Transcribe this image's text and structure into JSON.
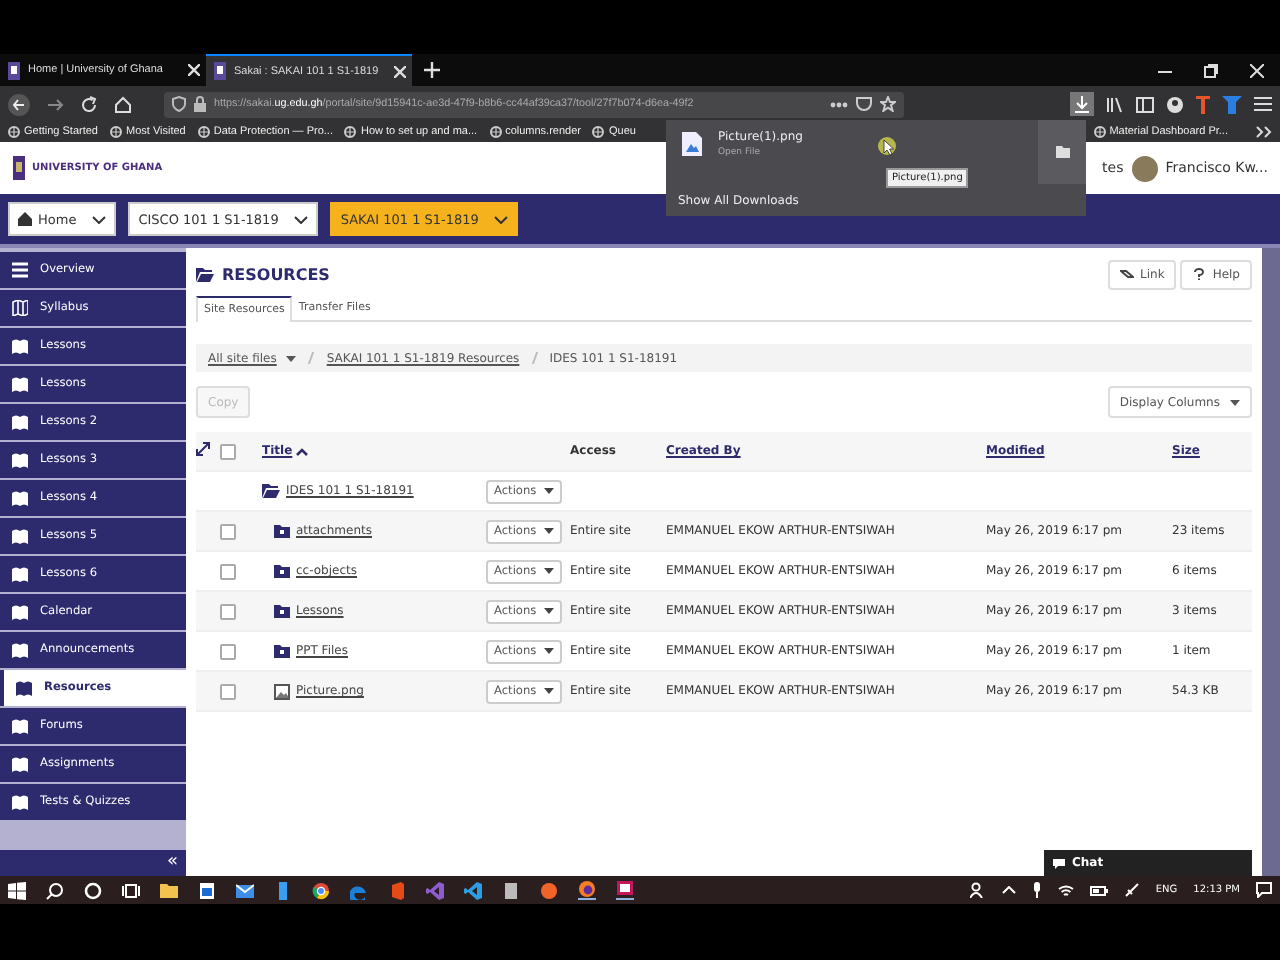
{
  "browser": {
    "tabs": [
      {
        "title": "Home | University of Ghana",
        "selected": false
      },
      {
        "title": "Sakai : SAKAI 101 1 S1-1819",
        "selected": true
      }
    ],
    "url": {
      "prefix": "https://sakai.",
      "domain": "ug.edu.gh",
      "path": "/portal/site/9d15941c-ae3d-47f9-b8b6-cc44af39ca37/tool/27f7b074-d6ea-49f2"
    },
    "bookmarks": [
      "Getting Started",
      "Most Visited",
      "Data Protection — Pro...",
      "How to set up and ma...",
      "columns.render",
      "Queu",
      "Material Dashboard Pr..."
    ],
    "downloads": {
      "file": "Picture(1).png",
      "action": "Open File",
      "tooltip": "Picture(1).png",
      "show_all": "Show All Downloads"
    }
  },
  "site_header": {
    "logo": "UNIVERSITY OF GHANA",
    "partial_link": "tes",
    "user": "Francisco Kw..."
  },
  "course_nav": [
    {
      "label": "Home",
      "selected": false
    },
    {
      "label": "CISCO 101 1 S1-1819",
      "selected": false
    },
    {
      "label": "SAKAI 101 1 S1-1819",
      "selected": true
    }
  ],
  "sidebar": {
    "items": [
      {
        "label": "Overview",
        "selected": false
      },
      {
        "label": "Syllabus",
        "selected": false
      },
      {
        "label": "Lessons",
        "selected": false
      },
      {
        "label": "Lessons",
        "selected": false
      },
      {
        "label": "Lessons 2",
        "selected": false
      },
      {
        "label": "Lessons 3",
        "selected": false
      },
      {
        "label": "Lessons 4",
        "selected": false
      },
      {
        "label": "Lessons 5",
        "selected": false
      },
      {
        "label": "Lessons 6",
        "selected": false
      },
      {
        "label": "Calendar",
        "selected": false
      },
      {
        "label": "Announcements",
        "selected": false
      },
      {
        "label": "Resources",
        "selected": true
      },
      {
        "label": "Forums",
        "selected": false
      },
      {
        "label": "Assignments",
        "selected": false
      },
      {
        "label": "Tests & Quizzes",
        "selected": false
      }
    ],
    "collapse": "«"
  },
  "page": {
    "title": "RESOURCES",
    "buttons": [
      "Link",
      "Help"
    ],
    "tabs": [
      {
        "label": "Site Resources",
        "selected": true
      },
      {
        "label": "Transfer Files",
        "selected": false
      }
    ],
    "breadcrumbs": [
      "All site files",
      "SAKAI 101 1 S1-1819 Resources",
      "IDES 101 1 S1-18191"
    ],
    "copy": {
      "label": "Copy",
      "disabled": true
    },
    "display_columns": "Display Columns",
    "table": {
      "select_all_checked": false,
      "columns": [
        "Title",
        "Access",
        "Created By",
        "Modified",
        "Size"
      ],
      "parent": {
        "title": "IDES 101 1 S1-18191",
        "actions": "Actions"
      },
      "rows": [
        {
          "kind": "folder",
          "title": "attachments",
          "actions": "Actions",
          "access": "Entire site",
          "created_by": "EMMANUEL EKOW ARTHUR-ENTSIWAH",
          "modified": "May 26, 2019 6:17 pm",
          "size": "23 items",
          "checked": false
        },
        {
          "kind": "folder",
          "title": "cc-objects",
          "actions": "Actions",
          "access": "Entire site",
          "created_by": "EMMANUEL EKOW ARTHUR-ENTSIWAH",
          "modified": "May 26, 2019 6:17 pm",
          "size": "6 items",
          "checked": false
        },
        {
          "kind": "folder",
          "title": "Lessons",
          "actions": "Actions",
          "access": "Entire site",
          "created_by": "EMMANUEL EKOW ARTHUR-ENTSIWAH",
          "modified": "May 26, 2019 6:17 pm",
          "size": "3 items",
          "checked": false
        },
        {
          "kind": "folder",
          "title": "PPT Files",
          "actions": "Actions",
          "access": "Entire site",
          "created_by": "EMMANUEL EKOW ARTHUR-ENTSIWAH",
          "modified": "May 26, 2019 6:17 pm",
          "size": "1 item",
          "checked": false
        },
        {
          "kind": "image",
          "title": "Picture.png",
          "actions": "Actions",
          "access": "Entire site",
          "created_by": "EMMANUEL EKOW ARTHUR-ENTSIWAH",
          "modified": "May 26, 2019 6:17 pm",
          "size": "54.3 KB",
          "checked": false
        }
      ]
    }
  },
  "chat": "Chat",
  "taskbar": {
    "lang": "ENG",
    "time": "12:13 PM"
  }
}
